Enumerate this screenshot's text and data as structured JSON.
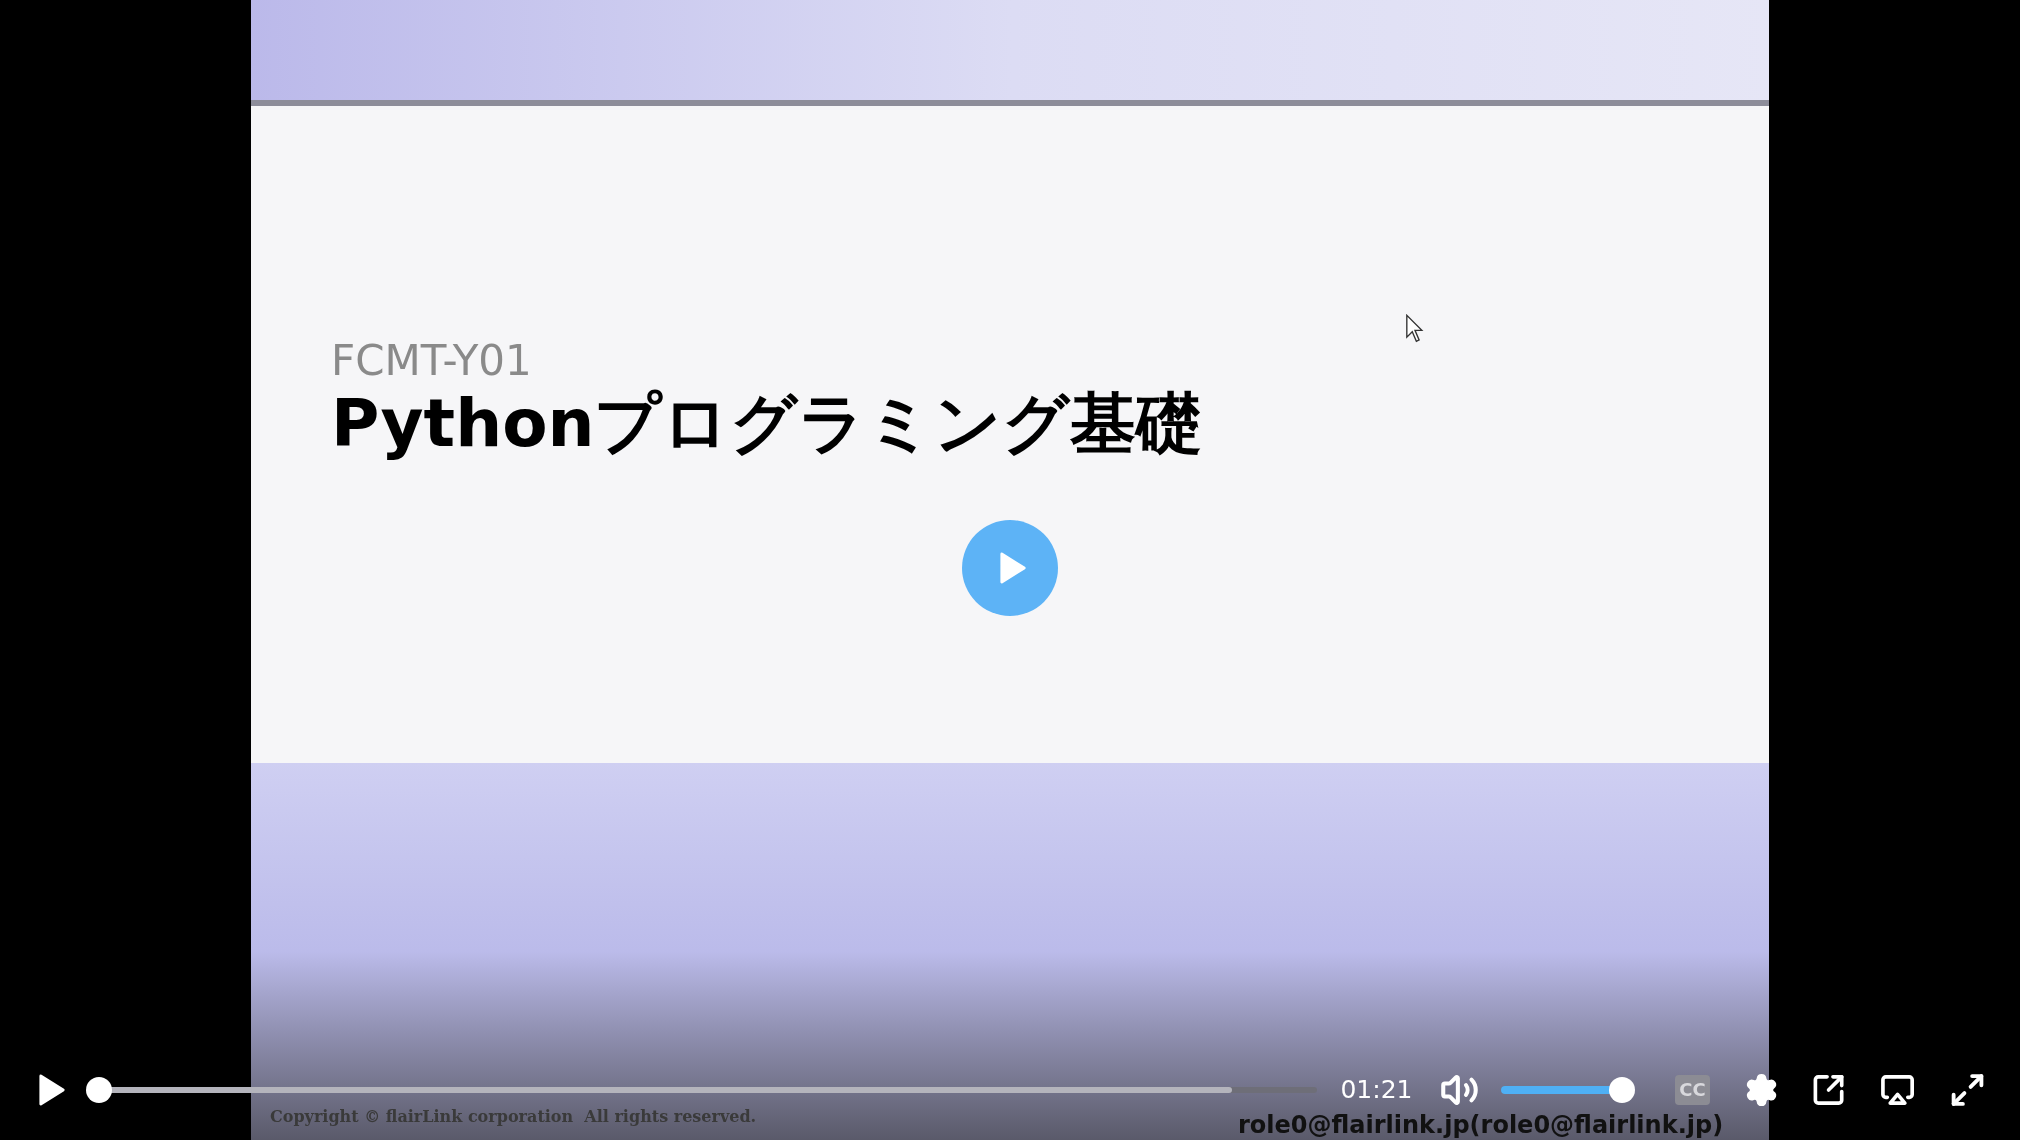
{
  "slide": {
    "code": "FCMT-Y01",
    "title": "Pythonプログラミング基礎",
    "copyright": "Copyright © flairLink corporation  All rights reserved."
  },
  "viewer_label": "role0@flairlink.jp(role0@flairlink.jp)",
  "player": {
    "playing": false,
    "progress": {
      "level": 0.0
    },
    "buffer": {
      "level": 0.93
    },
    "time": "01:21",
    "volume": {
      "level": 1.0,
      "muted": false
    },
    "captions": {
      "label": "CC",
      "on": false
    }
  }
}
